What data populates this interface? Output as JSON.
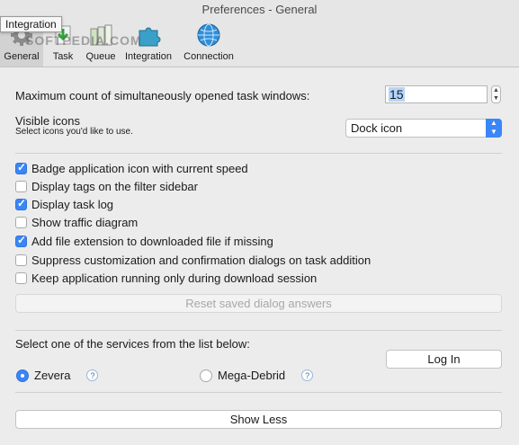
{
  "window": {
    "title": "Preferences - General",
    "tooltip": "Integration"
  },
  "toolbar": {
    "items": [
      {
        "label": "General",
        "icon": "general-icon"
      },
      {
        "label": "Task",
        "icon": "task-icon"
      },
      {
        "label": "Queue",
        "icon": "queue-icon"
      },
      {
        "label": "Integration",
        "icon": "integration-icon"
      },
      {
        "label": "Connection",
        "icon": "connection-icon"
      }
    ],
    "watermark": "SOFTPEDIA.COM"
  },
  "general": {
    "max_windows_label": "Maximum count of simultaneously opened task windows:",
    "max_windows_value": "15",
    "visible_icons_label": "Visible icons",
    "visible_icons_hint": "Select icons you'd like to use.",
    "visible_icons_selected": "Dock icon",
    "checkboxes": [
      {
        "label": "Badge application icon with current speed",
        "checked": true
      },
      {
        "label": "Display tags on the filter sidebar",
        "checked": false
      },
      {
        "label": "Display task log",
        "checked": true
      },
      {
        "label": "Show traffic diagram",
        "checked": false
      },
      {
        "label": "Add file extension to downloaded file if missing",
        "checked": true
      },
      {
        "label": "Suppress customization and confirmation dialogs on task addition",
        "checked": false
      },
      {
        "label": "Keep application running only during download session",
        "checked": false
      }
    ],
    "reset_button": "Reset saved dialog answers",
    "services_label": "Select one of the services from the list below:",
    "services": [
      {
        "label": "Zevera",
        "selected": true
      },
      {
        "label": "Mega-Debrid",
        "selected": false
      }
    ],
    "login_button": "Log In",
    "show_less_button": "Show Less"
  },
  "colors": {
    "accent": "#3a86f7"
  }
}
